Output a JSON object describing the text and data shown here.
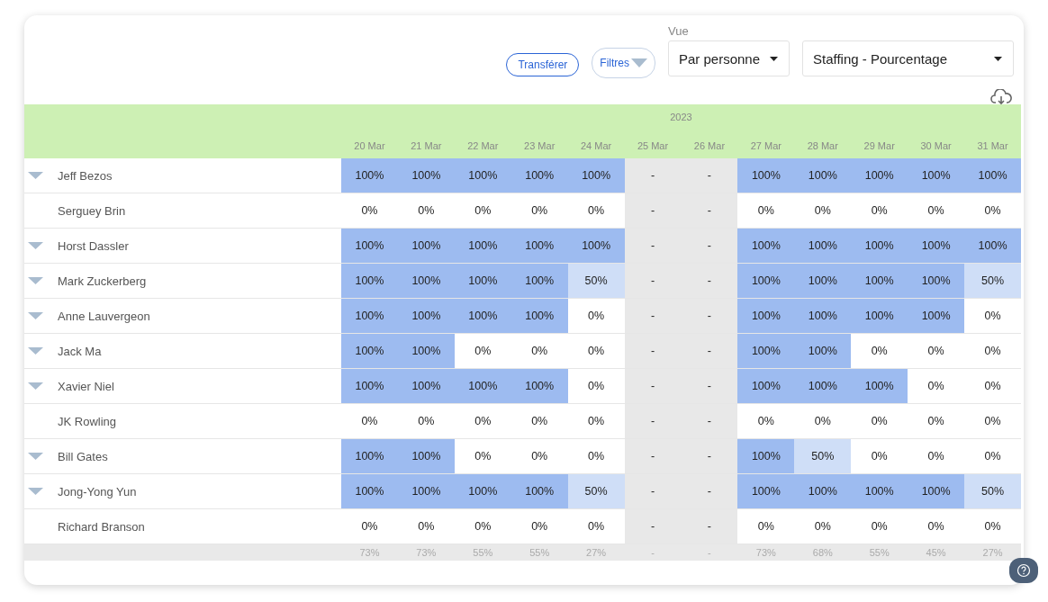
{
  "toolbar": {
    "transfer_button": "Transférer",
    "filters_button": "Filtres",
    "view_label": "Vue",
    "view_select": "Par personne",
    "metric_select": "Staffing - Pourcentage"
  },
  "table": {
    "year": "2023",
    "columns": [
      "20 Mar",
      "21 Mar",
      "22 Mar",
      "23 Mar",
      "24 Mar",
      "25 Mar",
      "26 Mar",
      "27 Mar",
      "28 Mar",
      "29 Mar",
      "30 Mar",
      "31 Mar"
    ],
    "rows": [
      {
        "name": "Jeff Bezos",
        "expandable": true,
        "cells": [
          {
            "value": "100%",
            "kind": "full"
          },
          {
            "value": "100%",
            "kind": "full"
          },
          {
            "value": "100%",
            "kind": "full"
          },
          {
            "value": "100%",
            "kind": "full"
          },
          {
            "value": "100%",
            "kind": "full"
          },
          {
            "value": "-",
            "kind": "off"
          },
          {
            "value": "-",
            "kind": "off"
          },
          {
            "value": "100%",
            "kind": "full"
          },
          {
            "value": "100%",
            "kind": "full"
          },
          {
            "value": "100%",
            "kind": "full"
          },
          {
            "value": "100%",
            "kind": "full"
          },
          {
            "value": "100%",
            "kind": "full"
          }
        ]
      },
      {
        "name": "Serguey Brin",
        "expandable": false,
        "cells": [
          {
            "value": "0%",
            "kind": "empty"
          },
          {
            "value": "0%",
            "kind": "empty"
          },
          {
            "value": "0%",
            "kind": "empty"
          },
          {
            "value": "0%",
            "kind": "empty"
          },
          {
            "value": "0%",
            "kind": "empty"
          },
          {
            "value": "-",
            "kind": "off"
          },
          {
            "value": "-",
            "kind": "off"
          },
          {
            "value": "0%",
            "kind": "empty"
          },
          {
            "value": "0%",
            "kind": "empty"
          },
          {
            "value": "0%",
            "kind": "empty"
          },
          {
            "value": "0%",
            "kind": "empty"
          },
          {
            "value": "0%",
            "kind": "empty"
          }
        ]
      },
      {
        "name": "Horst Dassler",
        "expandable": true,
        "cells": [
          {
            "value": "100%",
            "kind": "full"
          },
          {
            "value": "100%",
            "kind": "full"
          },
          {
            "value": "100%",
            "kind": "full"
          },
          {
            "value": "100%",
            "kind": "full"
          },
          {
            "value": "100%",
            "kind": "full"
          },
          {
            "value": "-",
            "kind": "off"
          },
          {
            "value": "-",
            "kind": "off"
          },
          {
            "value": "100%",
            "kind": "full"
          },
          {
            "value": "100%",
            "kind": "full"
          },
          {
            "value": "100%",
            "kind": "full"
          },
          {
            "value": "100%",
            "kind": "full"
          },
          {
            "value": "100%",
            "kind": "full"
          }
        ]
      },
      {
        "name": "Mark Zuckerberg",
        "expandable": true,
        "cells": [
          {
            "value": "100%",
            "kind": "full"
          },
          {
            "value": "100%",
            "kind": "full"
          },
          {
            "value": "100%",
            "kind": "full"
          },
          {
            "value": "100%",
            "kind": "full"
          },
          {
            "value": "50%",
            "kind": "partial"
          },
          {
            "value": "-",
            "kind": "off"
          },
          {
            "value": "-",
            "kind": "off"
          },
          {
            "value": "100%",
            "kind": "full"
          },
          {
            "value": "100%",
            "kind": "full"
          },
          {
            "value": "100%",
            "kind": "full"
          },
          {
            "value": "100%",
            "kind": "full"
          },
          {
            "value": "50%",
            "kind": "partial"
          }
        ]
      },
      {
        "name": "Anne Lauvergeon",
        "expandable": true,
        "cells": [
          {
            "value": "100%",
            "kind": "full"
          },
          {
            "value": "100%",
            "kind": "full"
          },
          {
            "value": "100%",
            "kind": "full"
          },
          {
            "value": "100%",
            "kind": "full"
          },
          {
            "value": "0%",
            "kind": "empty"
          },
          {
            "value": "-",
            "kind": "off"
          },
          {
            "value": "-",
            "kind": "off"
          },
          {
            "value": "100%",
            "kind": "full"
          },
          {
            "value": "100%",
            "kind": "full"
          },
          {
            "value": "100%",
            "kind": "full"
          },
          {
            "value": "100%",
            "kind": "full"
          },
          {
            "value": "0%",
            "kind": "empty"
          }
        ]
      },
      {
        "name": "Jack Ma",
        "expandable": true,
        "cells": [
          {
            "value": "100%",
            "kind": "full"
          },
          {
            "value": "100%",
            "kind": "full"
          },
          {
            "value": "0%",
            "kind": "empty"
          },
          {
            "value": "0%",
            "kind": "empty"
          },
          {
            "value": "0%",
            "kind": "empty"
          },
          {
            "value": "-",
            "kind": "off"
          },
          {
            "value": "-",
            "kind": "off"
          },
          {
            "value": "100%",
            "kind": "full"
          },
          {
            "value": "100%",
            "kind": "full"
          },
          {
            "value": "0%",
            "kind": "empty"
          },
          {
            "value": "0%",
            "kind": "empty"
          },
          {
            "value": "0%",
            "kind": "empty"
          }
        ]
      },
      {
        "name": "Xavier Niel",
        "expandable": true,
        "cells": [
          {
            "value": "100%",
            "kind": "full"
          },
          {
            "value": "100%",
            "kind": "full"
          },
          {
            "value": "100%",
            "kind": "full"
          },
          {
            "value": "100%",
            "kind": "full"
          },
          {
            "value": "0%",
            "kind": "empty"
          },
          {
            "value": "-",
            "kind": "off"
          },
          {
            "value": "-",
            "kind": "off"
          },
          {
            "value": "100%",
            "kind": "full"
          },
          {
            "value": "100%",
            "kind": "full"
          },
          {
            "value": "100%",
            "kind": "full"
          },
          {
            "value": "0%",
            "kind": "empty"
          },
          {
            "value": "0%",
            "kind": "empty"
          }
        ]
      },
      {
        "name": "JK Rowling",
        "expandable": false,
        "cells": [
          {
            "value": "0%",
            "kind": "empty"
          },
          {
            "value": "0%",
            "kind": "empty"
          },
          {
            "value": "0%",
            "kind": "empty"
          },
          {
            "value": "0%",
            "kind": "empty"
          },
          {
            "value": "0%",
            "kind": "empty"
          },
          {
            "value": "-",
            "kind": "off"
          },
          {
            "value": "-",
            "kind": "off"
          },
          {
            "value": "0%",
            "kind": "empty"
          },
          {
            "value": "0%",
            "kind": "empty"
          },
          {
            "value": "0%",
            "kind": "empty"
          },
          {
            "value": "0%",
            "kind": "empty"
          },
          {
            "value": "0%",
            "kind": "empty"
          }
        ]
      },
      {
        "name": "Bill Gates",
        "expandable": true,
        "cells": [
          {
            "value": "100%",
            "kind": "full"
          },
          {
            "value": "100%",
            "kind": "full"
          },
          {
            "value": "0%",
            "kind": "empty"
          },
          {
            "value": "0%",
            "kind": "empty"
          },
          {
            "value": "0%",
            "kind": "empty"
          },
          {
            "value": "-",
            "kind": "off"
          },
          {
            "value": "-",
            "kind": "off"
          },
          {
            "value": "100%",
            "kind": "full"
          },
          {
            "value": "50%",
            "kind": "partial"
          },
          {
            "value": "0%",
            "kind": "empty"
          },
          {
            "value": "0%",
            "kind": "empty"
          },
          {
            "value": "0%",
            "kind": "empty"
          }
        ]
      },
      {
        "name": "Jong-Yong Yun",
        "expandable": true,
        "cells": [
          {
            "value": "100%",
            "kind": "full"
          },
          {
            "value": "100%",
            "kind": "full"
          },
          {
            "value": "100%",
            "kind": "full"
          },
          {
            "value": "100%",
            "kind": "full"
          },
          {
            "value": "50%",
            "kind": "partial"
          },
          {
            "value": "-",
            "kind": "off"
          },
          {
            "value": "-",
            "kind": "off"
          },
          {
            "value": "100%",
            "kind": "full"
          },
          {
            "value": "100%",
            "kind": "full"
          },
          {
            "value": "100%",
            "kind": "full"
          },
          {
            "value": "100%",
            "kind": "full"
          },
          {
            "value": "50%",
            "kind": "partial"
          }
        ]
      },
      {
        "name": "Richard Branson",
        "expandable": false,
        "cells": [
          {
            "value": "0%",
            "kind": "empty"
          },
          {
            "value": "0%",
            "kind": "empty"
          },
          {
            "value": "0%",
            "kind": "empty"
          },
          {
            "value": "0%",
            "kind": "empty"
          },
          {
            "value": "0%",
            "kind": "empty"
          },
          {
            "value": "-",
            "kind": "off"
          },
          {
            "value": "-",
            "kind": "off"
          },
          {
            "value": "0%",
            "kind": "empty"
          },
          {
            "value": "0%",
            "kind": "empty"
          },
          {
            "value": "0%",
            "kind": "empty"
          },
          {
            "value": "0%",
            "kind": "empty"
          },
          {
            "value": "0%",
            "kind": "empty"
          }
        ]
      }
    ],
    "totals": [
      "73%",
      "73%",
      "55%",
      "55%",
      "27%",
      "-",
      "-",
      "73%",
      "68%",
      "55%",
      "45%",
      "27%"
    ]
  }
}
